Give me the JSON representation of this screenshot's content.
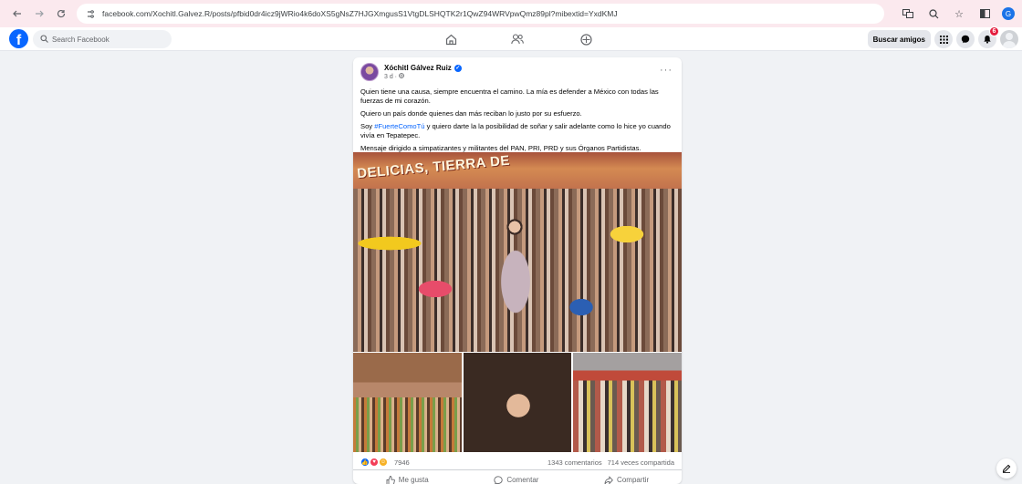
{
  "browser": {
    "url": "facebook.com/Xochitl.Galvez.R/posts/pfbid0dr4icz9jWRio4k6doXS5gNsZ7HJGXmgusS1VtgDLSHQTK2r1QwZ94WRVpwQmz89pl?mibextid=YxdKMJ",
    "profile_initial": "G"
  },
  "fb_header": {
    "logo": "f",
    "search_placeholder": "Search Facebook",
    "find_friends_label": "Buscar amigos",
    "notification_count": "6"
  },
  "post": {
    "author": "Xóchitl Gálvez Ruiz",
    "time": "3 d ·",
    "paragraphs": {
      "p1": "Quien tiene una causa, siempre encuentra el camino. La mía es defender a México con todas las fuerzas de mi corazón.",
      "p2": "Quiero un país donde quienes dan más reciban lo justo por su esfuerzo.",
      "p3_before": "Soy ",
      "p3_hashtag": "#FuerteComoTú",
      "p3_after": " y quiero darte la la posibilidad de soñar y salir adelante como lo hice yo cuando vivía en Tepatepec.",
      "p4": "Mensaje dirigido a simpatizantes y militantes del PAN, PRI, PRD y sus Órganos Partidistas."
    },
    "banner_text": "DELICIAS, TIERRA DE",
    "reaction_count": "7946",
    "comments": "1343 comentarios",
    "shares": "714 veces compartida",
    "actions": {
      "like": "Me gusta",
      "comment": "Comentar",
      "share": "Compartir"
    }
  },
  "icons": [
    "back-icon",
    "forward-icon",
    "reload-icon",
    "site-info-icon",
    "translate-icon",
    "zoom-icon",
    "star-icon",
    "sidebar-icon",
    "home-icon",
    "friends-icon",
    "groups-icon",
    "menu-grid-icon",
    "messenger-icon",
    "bell-icon",
    "compose-icon"
  ],
  "colors": {
    "facebook_blue": "#0866ff",
    "notification_red": "#e41e3f",
    "browser_bar": "#fbe9ee"
  }
}
